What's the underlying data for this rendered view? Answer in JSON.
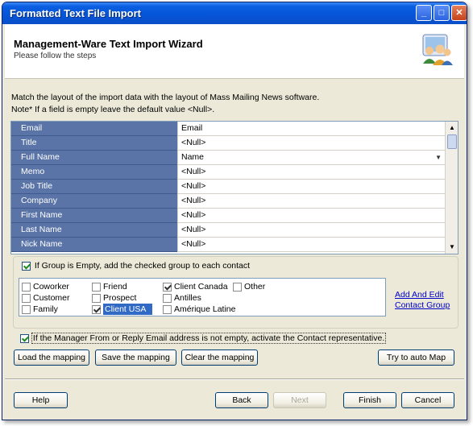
{
  "window": {
    "title": "Formatted Text File Import"
  },
  "header": {
    "title": "Management-Ware Text Import Wizard",
    "subtitle": "Please follow the steps"
  },
  "intro": {
    "line1": "Match the layout of the import data with the layout of Mass Mailing News software.",
    "line2": "Note* If a field is empty leave the default value <Null>."
  },
  "mapping_rows": [
    {
      "field": "Email",
      "value": "Email"
    },
    {
      "field": "Title",
      "value": "<Null>"
    },
    {
      "field": "Full Name",
      "value": "Name"
    },
    {
      "field": "Memo",
      "value": "<Null>"
    },
    {
      "field": "Job Title",
      "value": "<Null>"
    },
    {
      "field": "Company",
      "value": "<Null>"
    },
    {
      "field": "First Name",
      "value": "<Null>"
    },
    {
      "field": "Last Name",
      "value": "<Null>"
    },
    {
      "field": "Nick Name",
      "value": "<Null>"
    }
  ],
  "group_option": {
    "label": "If Group is Empty, add the checked group to each contact",
    "checked": true
  },
  "groups": [
    {
      "label": "Coworker",
      "checked": false
    },
    {
      "label": "Customer",
      "checked": false
    },
    {
      "label": "Family",
      "checked": false
    },
    {
      "label": "Friend",
      "checked": false
    },
    {
      "label": "Prospect",
      "checked": false
    },
    {
      "label": "Client USA",
      "checked": true
    },
    {
      "label": "Client Canada",
      "checked": true
    },
    {
      "label": "Antilles",
      "checked": false
    },
    {
      "label": "Amérique Latine",
      "checked": false
    },
    {
      "label": "Other",
      "checked": false
    }
  ],
  "links": {
    "add_group_line1": "Add And Edit",
    "add_group_line2": "Contact Group"
  },
  "manager_option": {
    "label": "If the Manager From or Reply Email address is not empty, activate the Contact representative.",
    "checked": true
  },
  "buttons": {
    "load": "Load the mapping",
    "save": "Save the mapping",
    "clear": "Clear the mapping",
    "auto": "Try to auto Map",
    "help": "Help",
    "back": "Back",
    "next": "Next",
    "finish": "Finish",
    "cancel": "Cancel"
  },
  "icons": {
    "wizard": "users-group-icon",
    "dropdown": "chevron-down-icon"
  },
  "colors": {
    "title_bar": "#0a5fe0",
    "grid_label_bg": "#5a74a8",
    "selection": "#316ac5",
    "link": "#0000cc"
  }
}
